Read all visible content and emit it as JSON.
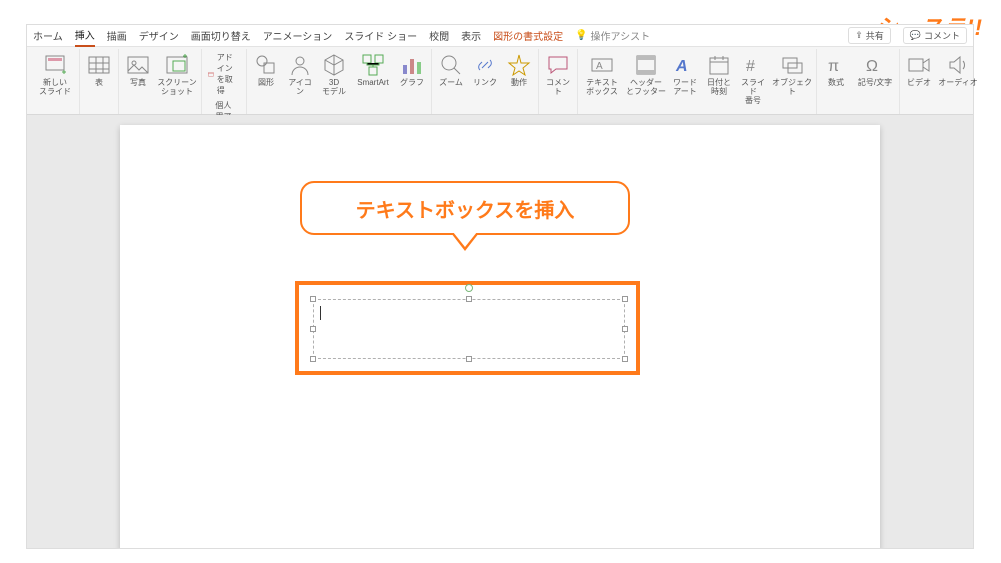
{
  "watermark": "シースラ!!",
  "tabs": {
    "home": "ホーム",
    "insert": "挿入",
    "draw": "描画",
    "design": "デザイン",
    "transitions": "画面切り替え",
    "animations": "アニメーション",
    "slideshow": "スライド ショー",
    "review": "校閲",
    "view": "表示",
    "shape_format": "図形の書式設定",
    "assist": "操作アシスト",
    "share": "共有",
    "comment": "コメント"
  },
  "ribbon": {
    "new_slide": "新しい\nスライド",
    "table": "表",
    "pictures": "写真",
    "screenshot": "スクリーン\nショット",
    "get_addins": "アドインを取得",
    "my_addins": "個人用アドイン",
    "shapes": "図形",
    "icons": "アイコン",
    "models3d": "3D\nモデル",
    "smartart": "SmartArt",
    "chart": "グラフ",
    "zoom": "ズーム",
    "link": "リンク",
    "action": "動作",
    "comment": "コメント",
    "textbox": "テキスト\nボックス",
    "header_footer": "ヘッダー\nとフッター",
    "wordart": "ワード\nアート",
    "date_time": "日付と\n時刻",
    "slide_number": "スライド\n番号",
    "object": "オブジェクト",
    "equation": "数式",
    "symbol": "記号/文字",
    "video": "ビデオ",
    "audio": "オーディオ"
  },
  "callout": "テキストボックスを挿入"
}
